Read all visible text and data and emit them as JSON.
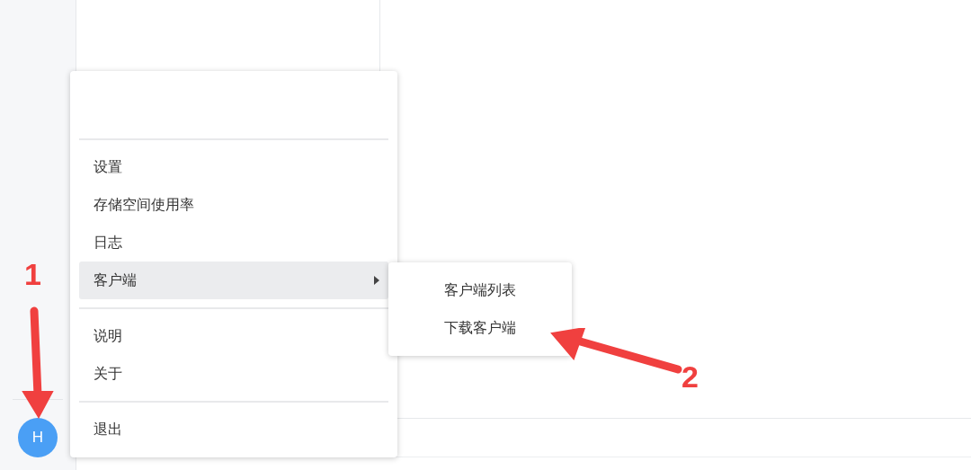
{
  "avatar": {
    "letter": "H"
  },
  "menu": {
    "sections": [
      {
        "items": [
          {
            "label": "设置",
            "kind": "action",
            "selected": false
          },
          {
            "label": "存储空间使用率",
            "kind": "action",
            "selected": false
          },
          {
            "label": "日志",
            "kind": "action",
            "selected": false
          },
          {
            "label": "客户端",
            "kind": "submenu",
            "selected": true
          }
        ]
      },
      {
        "items": [
          {
            "label": "说明",
            "kind": "action",
            "selected": false
          },
          {
            "label": "关于",
            "kind": "action",
            "selected": false
          }
        ]
      },
      {
        "items": [
          {
            "label": "退出",
            "kind": "action",
            "selected": false
          }
        ]
      }
    ]
  },
  "submenu": {
    "items": [
      {
        "label": "客户端列表"
      },
      {
        "label": "下载客户端"
      }
    ]
  },
  "annotations": [
    {
      "label": "1"
    },
    {
      "label": "2"
    }
  ]
}
